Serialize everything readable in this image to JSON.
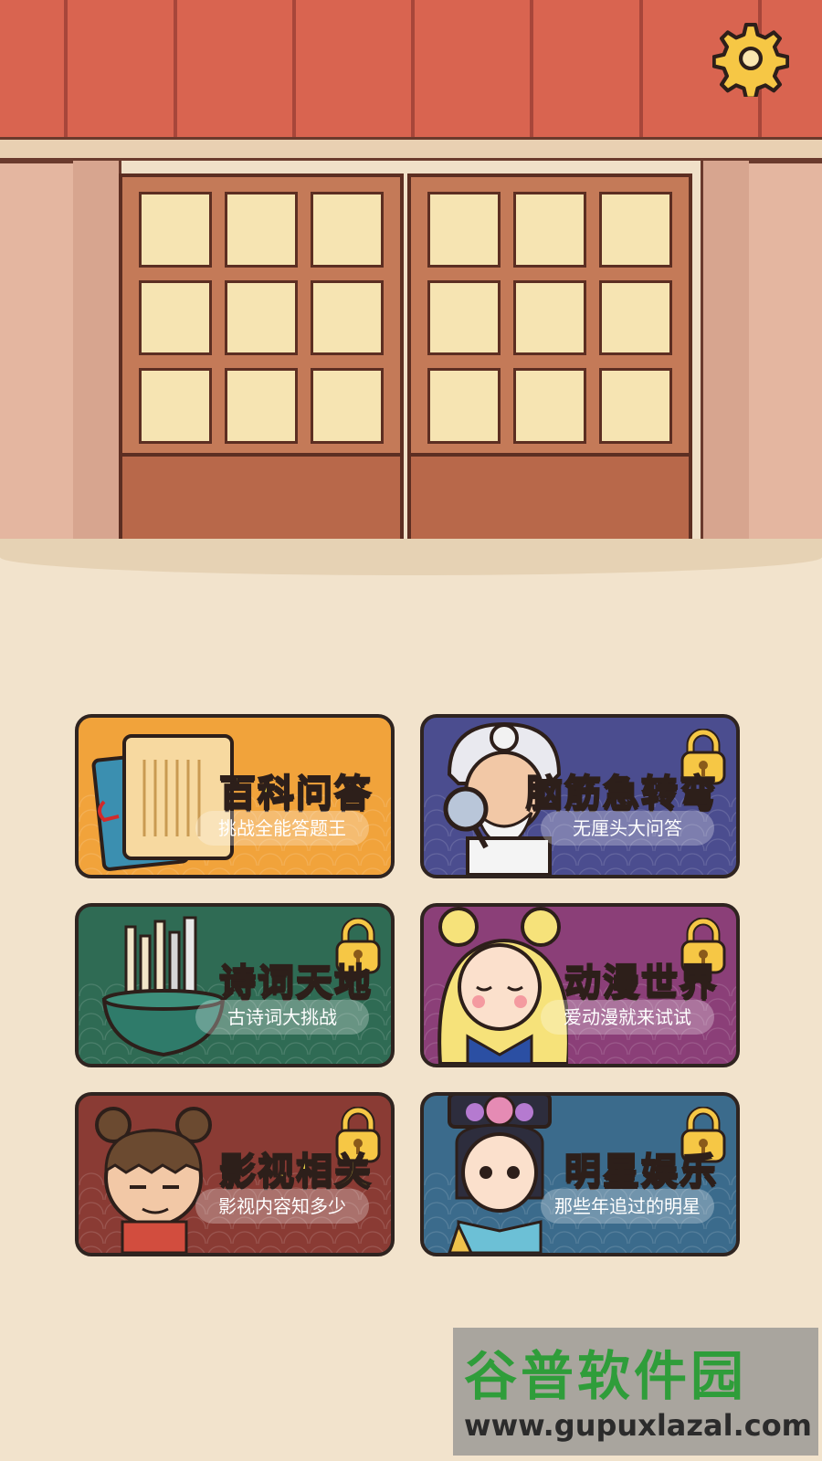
{
  "settings": {
    "icon": "gear-icon"
  },
  "categories": [
    {
      "title": "百科问答",
      "subtitle": "挑战全能答题王",
      "locked": false,
      "color": "#f1a33b",
      "art": "ancient-book-scroll"
    },
    {
      "title": "脑筋急转弯",
      "subtitle": "无厘头大问答",
      "locked": true,
      "color": "#4b4d8f",
      "art": "old-doctor-with-magnifier"
    },
    {
      "title": "诗词天地",
      "subtitle": "古诗词大挑战",
      "locked": true,
      "color": "#2f6b54",
      "art": "brush-pot"
    },
    {
      "title": "动漫世界",
      "subtitle": "爱动漫就来试试",
      "locked": true,
      "color": "#8b3f78",
      "art": "anime-girl"
    },
    {
      "title": "影视相关",
      "subtitle": "影视内容知多少",
      "locked": true,
      "color": "#8a3b34",
      "art": "cartoon-boy-with-buns"
    },
    {
      "title": "明星娱乐",
      "subtitle": "那些年追过的明星",
      "locked": true,
      "color": "#3b6b8c",
      "art": "qing-dynasty-lady"
    }
  ],
  "watermark": {
    "title": "谷普软件园",
    "url": "www.gupuxlazal.com"
  }
}
